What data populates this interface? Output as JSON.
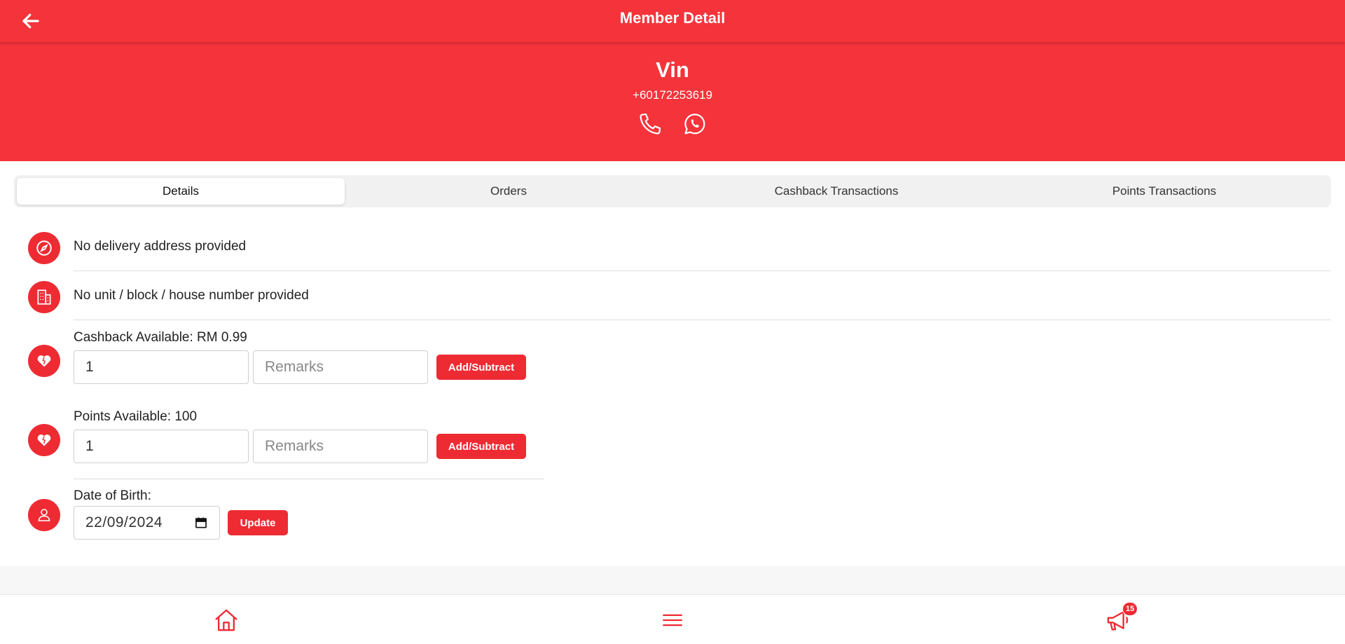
{
  "header": {
    "title": "Member Detail"
  },
  "member": {
    "name": "Vin",
    "phone": "+60172253619"
  },
  "tabs": [
    {
      "label": "Details"
    },
    {
      "label": "Orders"
    },
    {
      "label": "Cashback Transactions"
    },
    {
      "label": "Points Transactions"
    }
  ],
  "details": {
    "address": "No delivery address provided",
    "unit": "No unit / block / house number provided",
    "cashback": {
      "label": "Cashback Available: RM 0.99",
      "amount_value": "1",
      "remarks_placeholder": "Remarks",
      "button_label": "Add/Subtract"
    },
    "points": {
      "label": "Points Available: 100",
      "amount_value": "1",
      "remarks_placeholder": "Remarks",
      "button_label": "Add/Subtract"
    },
    "dob": {
      "label": "Date of Birth:",
      "value": "22/09/2024",
      "button_label": "Update"
    }
  },
  "bottom_nav": {
    "notification_count": "15"
  },
  "colors": {
    "accent": "#f5333a",
    "button": "#ee2b33"
  },
  "icons": {
    "back": "arrow-left-icon",
    "phone": "phone-icon",
    "whatsapp": "whatsapp-icon",
    "address": "compass-icon",
    "unit": "building-icon",
    "cashback": "heart-icon",
    "points": "heart-icon",
    "dob": "user-icon",
    "calendar": "calendar-icon",
    "home": "home-icon",
    "menu": "menu-icon",
    "announcement": "megaphone-icon"
  }
}
